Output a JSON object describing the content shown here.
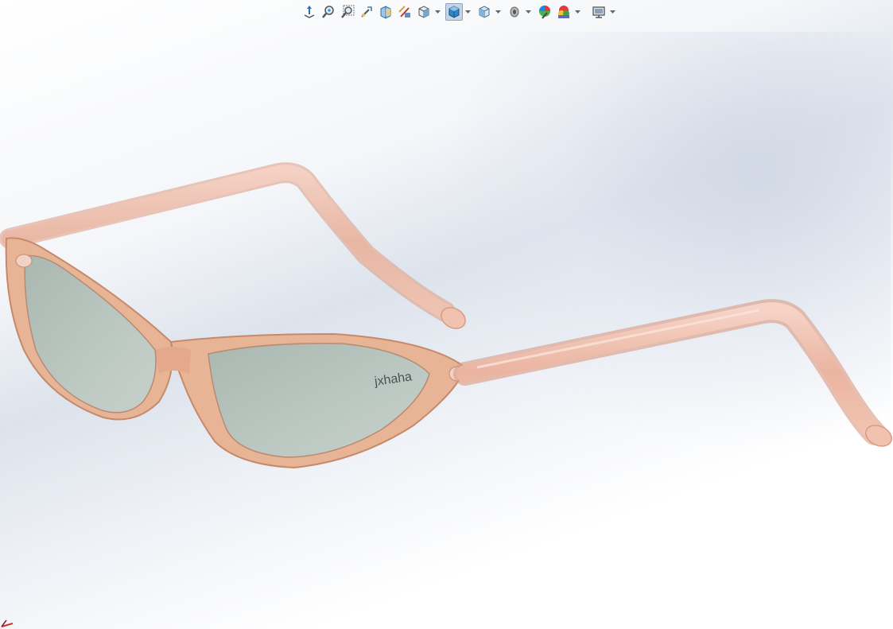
{
  "toolbar": {
    "items": [
      {
        "name": "view-orientation-icon",
        "dropdown": false
      },
      {
        "name": "zoom-to-fit-icon",
        "dropdown": false
      },
      {
        "name": "zoom-to-area-icon",
        "dropdown": false
      },
      {
        "name": "previous-view-icon",
        "dropdown": false
      },
      {
        "name": "section-view-icon",
        "dropdown": false
      },
      {
        "name": "dynamic-annotation-icon",
        "dropdown": false
      },
      {
        "name": "view-selector-icon",
        "dropdown": true
      },
      {
        "name": "shaded-display-style-icon",
        "dropdown": true,
        "active": true
      },
      {
        "name": "hide-show-items-icon",
        "dropdown": true
      },
      {
        "name": "visibility-eye-icon",
        "dropdown": true
      },
      {
        "name": "edit-appearance-icon",
        "dropdown": false
      },
      {
        "name": "apply-scene-icon",
        "dropdown": true
      },
      {
        "name": "view-settings-monitor-icon",
        "dropdown": true
      }
    ]
  },
  "model": {
    "watermark_text": "jxhaha",
    "frame_color": "#e9b49a",
    "frame_edge_color": "#c98c6e",
    "temple_color": "#f0c2b0",
    "lens_color": "#b7c3bd",
    "lens_dark_color": "#9fada6"
  },
  "colors": {
    "accent_blue": "#2e86c9",
    "background_top": "#ffffff",
    "background_mid": "#dde3ec"
  }
}
